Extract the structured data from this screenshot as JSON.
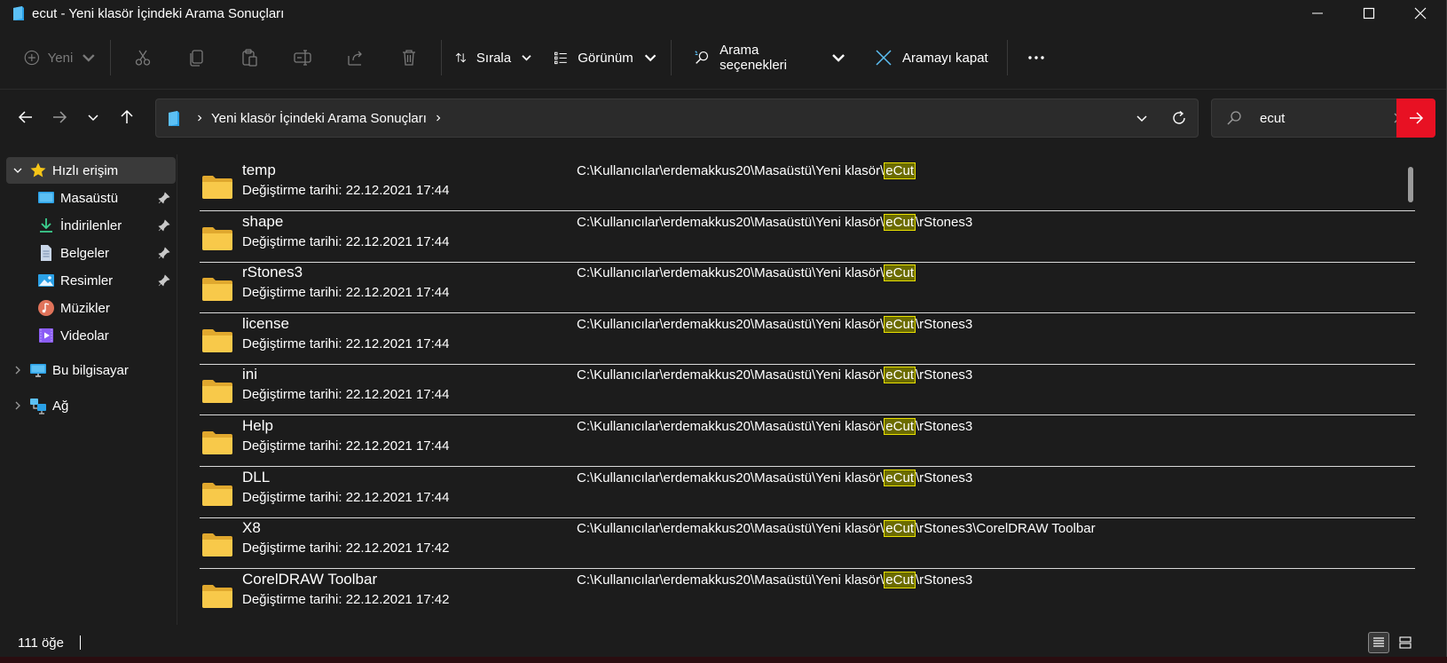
{
  "window": {
    "title": "ecut - Yeni klasör İçindeki Arama Sonuçları"
  },
  "toolbar": {
    "new_label": "Yeni",
    "sort_label": "Sırala",
    "view_label": "Görünüm",
    "search_options_label": "Arama seçenekleri",
    "close_search_label": "Aramayı kapat"
  },
  "address": {
    "crumbs": [
      "Yeni klasör İçindeki Arama Sonuçları"
    ]
  },
  "search": {
    "value": "ecut"
  },
  "sidebar": {
    "quick_access": "Hızlı erişim",
    "items": [
      {
        "label": "Masaüstü",
        "icon": "desktop-icon",
        "pinned": true
      },
      {
        "label": "İndirilenler",
        "icon": "download-icon",
        "pinned": true
      },
      {
        "label": "Belgeler",
        "icon": "documents-icon",
        "pinned": true
      },
      {
        "label": "Resimler",
        "icon": "pictures-icon",
        "pinned": true
      },
      {
        "label": "Müzikler",
        "icon": "music-icon",
        "pinned": false
      },
      {
        "label": "Videolar",
        "icon": "videos-icon",
        "pinned": false
      }
    ],
    "this_pc": "Bu bilgisayar",
    "network": "Ağ"
  },
  "results": {
    "date_prefix": "Değiştirme tarihi: ",
    "path_prefix": "C:\\Kullanıcılar\\erdemakkus20\\Masaüstü\\Yeni klasör\\",
    "highlight": "eCut",
    "items": [
      {
        "name": "temp",
        "date": "22.12.2021 17:44",
        "suffix": ""
      },
      {
        "name": "shape",
        "date": "22.12.2021 17:44",
        "suffix": "\\rStones3"
      },
      {
        "name": "rStones3",
        "date": "22.12.2021 17:44",
        "suffix": ""
      },
      {
        "name": "license",
        "date": "22.12.2021 17:44",
        "suffix": "\\rStones3"
      },
      {
        "name": "ini",
        "date": "22.12.2021 17:44",
        "suffix": "\\rStones3"
      },
      {
        "name": "Help",
        "date": "22.12.2021 17:44",
        "suffix": "\\rStones3"
      },
      {
        "name": "DLL",
        "date": "22.12.2021 17:44",
        "suffix": "\\rStones3"
      },
      {
        "name": "X8",
        "date": "22.12.2021 17:42",
        "suffix": "\\rStones3\\CorelDRAW Toolbar"
      },
      {
        "name": "CorelDRAW Toolbar",
        "date": "22.12.2021 17:42",
        "suffix": "\\rStones3"
      }
    ]
  },
  "status": {
    "count": "111 öğe"
  },
  "colors": {
    "background": "#1c1c1c",
    "highlight_bg": "#6b6b00",
    "highlight_border": "#e8e000",
    "search_go": "#e81123",
    "folder": "#f8c94a"
  }
}
